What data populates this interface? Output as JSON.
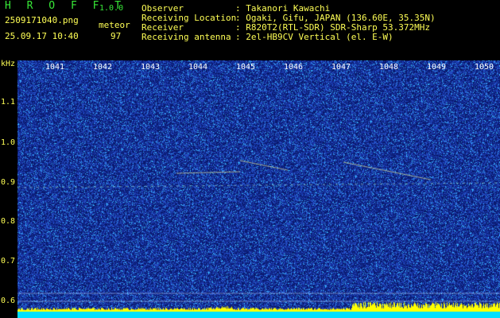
{
  "header": {
    "app_name": "H R O F F T",
    "version": "1.0.0",
    "filename": "2509171040.png",
    "timestamp": "25.09.17 10:40",
    "detector_label": "meteor",
    "detector_count": "97",
    "info_labels": [
      "Observer",
      "Receiving Location",
      "Receiver",
      "Receiving antenna"
    ],
    "info_values": [
      ": Takanori Kawachi",
      ": Ogaki, Gifu, JAPAN (136.60E, 35.35N)",
      ": R820T2(RTL-SDR) SDR-Sharp 53.372MHz",
      ": 2el-HB9CV Vertical (el. E-W)"
    ]
  },
  "spectrogram": {
    "y_unit": "kHz",
    "y_ticks": [
      "1.1",
      "1.0",
      "0.9",
      "0.8",
      "0.7",
      "0.6"
    ],
    "x_ticks": [
      "1041",
      "1042",
      "1043",
      "1044",
      "1045",
      "1046",
      "1047",
      "1048",
      "1049",
      "1050"
    ],
    "colors": {
      "background_dark": "#0a1a6e",
      "background_mid": "#1f3fb4",
      "noise_bright": "#38b8ff",
      "signal": "#ffff66",
      "bottom_level": "#ffff00",
      "bottom_base": "#00e0ff"
    }
  }
}
